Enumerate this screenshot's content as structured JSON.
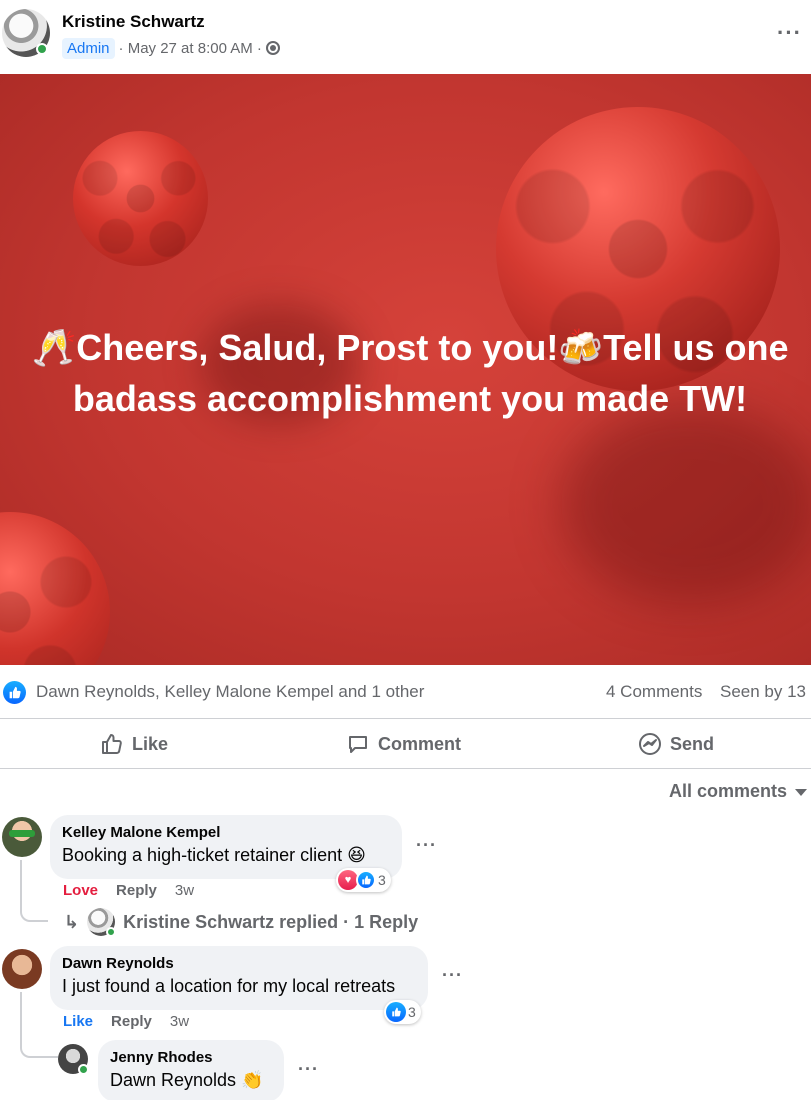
{
  "post": {
    "author": "Kristine Schwartz",
    "badge": "Admin",
    "timestamp": "· May 27 at 8:00 AM ·",
    "privacy_icon": "globe-icon",
    "image_text_line1": "🥂Cheers, Salud, Prost to you!🍻Tell us one",
    "image_text_line2": "badass accomplishment you made TW!"
  },
  "reactions": {
    "reactors": "Dawn Reynolds, Kelley Malone Kempel and 1 other",
    "comments": "4 Comments",
    "seen_by": "Seen by 13"
  },
  "actions": {
    "like": "Like",
    "comment": "Comment",
    "send": "Send"
  },
  "filter": {
    "label": "All comments"
  },
  "comments": [
    {
      "name": "Kelley Malone Kempel",
      "text": "Booking a high-ticket retainer client 😆",
      "reaction_label": "Love",
      "reply": "Reply",
      "time": "3w",
      "reaction_count": "3",
      "replies_summary": "Kristine Schwartz replied · 1 Reply"
    },
    {
      "name": "Dawn Reynolds",
      "text": "I just found a location for my local retreats",
      "reaction_label": "Like",
      "reply": "Reply",
      "time": "3w",
      "reaction_count": "3"
    }
  ],
  "nested_reply": {
    "name": "Jenny Rhodes",
    "text": "Dawn Reynolds 👏"
  },
  "colors": {
    "brand_blue": "#1877f2",
    "love_red": "#e41e3f",
    "image_red": "#c23630",
    "online_green": "#31a24c"
  }
}
